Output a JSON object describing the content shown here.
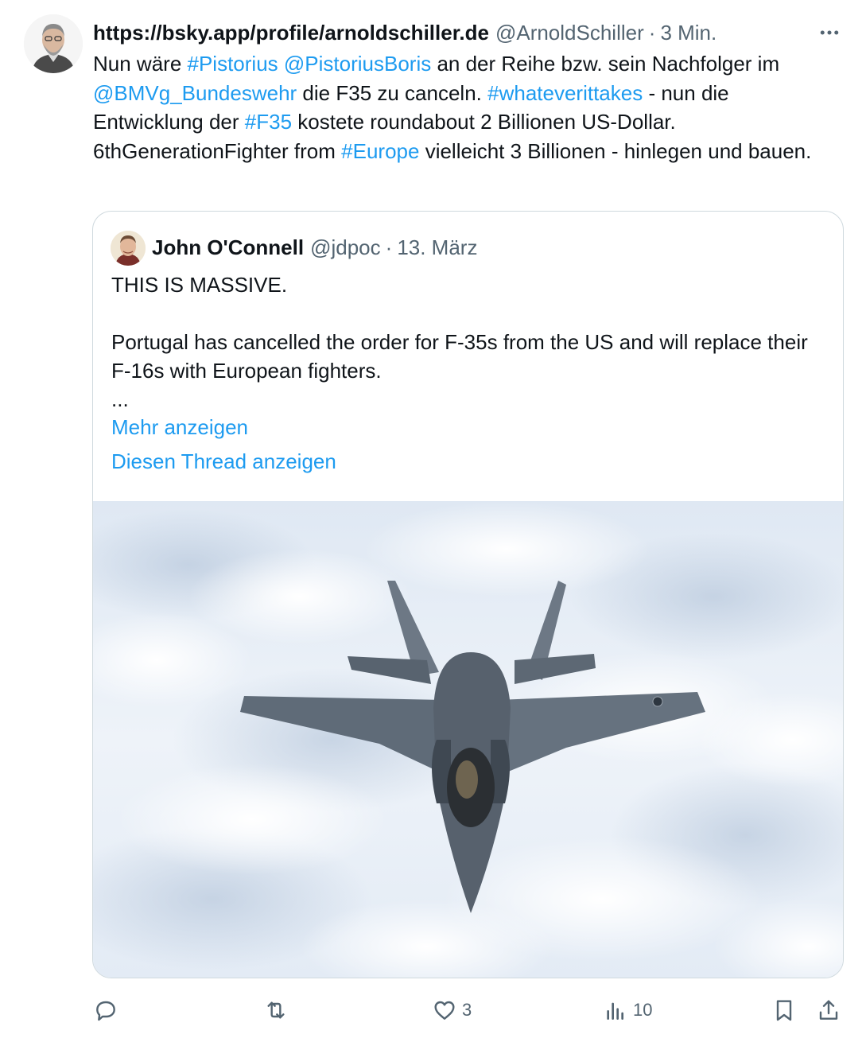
{
  "tweet": {
    "author_name": "https://bsky.app/profile/arnoldschiller.de",
    "handle": "@ArnoldSchiller",
    "separator": "·",
    "time": "3 Min.",
    "text_parts": [
      {
        "t": "Nun wäre ",
        "link": false
      },
      {
        "t": "#Pistorius",
        "link": true
      },
      {
        "t": " ",
        "link": false
      },
      {
        "t": "@PistoriusBoris",
        "link": true
      },
      {
        "t": " an der Reihe bzw. sein Nachfolger im ",
        "link": false
      },
      {
        "t": "@BMVg_Bundeswehr",
        "link": true
      },
      {
        "t": " die F35 zu canceln. ",
        "link": false
      },
      {
        "t": "#whateverittakes",
        "link": true
      },
      {
        "t": " - nun die Entwicklung der ",
        "link": false
      },
      {
        "t": "#F35",
        "link": true
      },
      {
        "t": " kostete roundabout 2 Billionen US-Dollar. 6thGenerationFighter from ",
        "link": false
      },
      {
        "t": "#Europe",
        "link": true
      },
      {
        "t": " vielleicht 3 Billionen - hinlegen und bauen.",
        "link": false
      }
    ]
  },
  "quote": {
    "author_name": "John O'Connell",
    "handle": "@jdpoc",
    "separator": "·",
    "date": "13. März",
    "line1": "THIS IS MASSIVE.",
    "line2": "Portugal has cancelled the order for F-35s from the US and will replace their F-16s with European fighters.",
    "ellipsis": "...",
    "show_more": "Mehr anzeigen",
    "show_thread": "Diesen Thread anzeigen"
  },
  "actions": {
    "reply_count": "",
    "retweet_count": "",
    "like_count": "3",
    "views_count": "10"
  },
  "colors": {
    "link": "#1d9bf0",
    "secondary_text": "#536471",
    "border": "#cfd9de"
  },
  "icons": [
    "more-icon",
    "reply-icon",
    "retweet-icon",
    "like-icon",
    "views-icon",
    "bookmark-icon",
    "share-icon"
  ]
}
